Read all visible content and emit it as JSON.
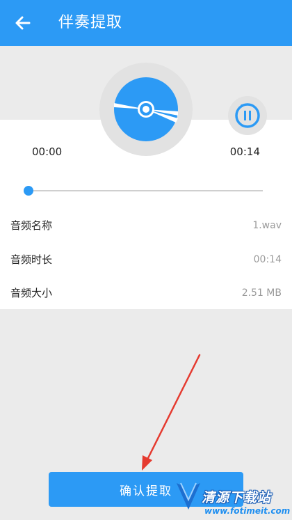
{
  "appbar": {
    "title": "伴奏提取",
    "back_icon": "arrow-left-icon"
  },
  "player": {
    "current_time": "00:00",
    "total_time": "00:14",
    "progress": 0,
    "disc_icon": "music-disc-icon",
    "pause_icon": "pause-icon"
  },
  "info": [
    {
      "label": "音频名称",
      "value": "1.wav"
    },
    {
      "label": "音频时长",
      "value": "00:14"
    },
    {
      "label": "音频大小",
      "value": "2.51 MB"
    }
  ],
  "confirm_label": "确认提取",
  "watermark": {
    "text": "清源下载站",
    "url": "www.fotimeit.com"
  },
  "colors": {
    "accent": "#2c9af5",
    "background": "#ebebeb",
    "arrow": "#e53a2f"
  }
}
